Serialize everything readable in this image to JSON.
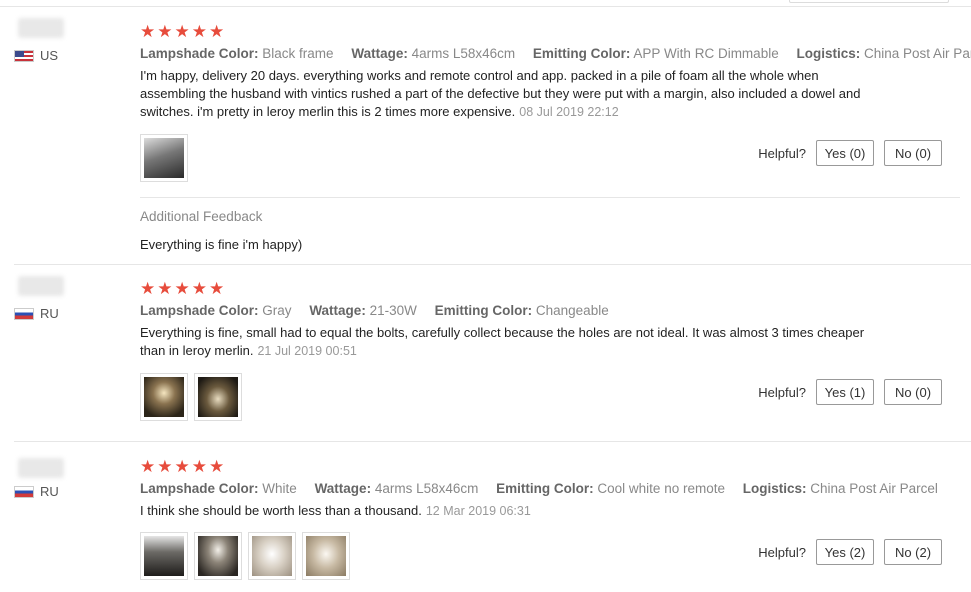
{
  "labels": {
    "helpful": "Helpful?",
    "additional_feedback": "Additional Feedback"
  },
  "reviews": [
    {
      "country": "US",
      "flag": "us-flag-icon",
      "stars": "★★★★★",
      "rating": 5,
      "attrs": [
        {
          "key": "Lampshade Color:",
          "value": "Black frame"
        },
        {
          "key": "Wattage:",
          "value": "4arms L58x46cm"
        },
        {
          "key": "Emitting Color:",
          "value": "APP With RC Dimmable"
        },
        {
          "key": "Logistics:",
          "value": "China Post Air Parcel"
        }
      ],
      "text": "I'm happy, delivery 20 days. everything works and remote control and app. packed in a pile of foam all the whole when assembling the husband with vintics rushed a part of the defective but they were put with a margin, also included a dowel and switches. i'm pretty in leroy merlin this is 2 times more expensive.",
      "date": "08 Jul 2019 22:12",
      "yes": "Yes (0)",
      "no": "No (0)",
      "additional": "Everything is fine i'm happy)"
    },
    {
      "country": "RU",
      "flag": "ru-flag-icon",
      "stars": "★★★★★",
      "rating": 5,
      "attrs": [
        {
          "key": "Lampshade Color:",
          "value": "Gray"
        },
        {
          "key": "Wattage:",
          "value": "21-30W"
        },
        {
          "key": "Emitting Color:",
          "value": "Changeable"
        }
      ],
      "text": "Everything is fine, small had to equal the bolts, carefully collect because the holes are not ideal. It was almost 3 times cheaper than in leroy merlin.",
      "date": "21 Jul 2019 00:51",
      "yes": "Yes (1)",
      "no": "No (0)"
    },
    {
      "country": "RU",
      "flag": "ru-flag-icon",
      "stars": "★★★★★",
      "rating": 5,
      "attrs": [
        {
          "key": "Lampshade Color:",
          "value": "White"
        },
        {
          "key": "Wattage:",
          "value": "4arms L58x46cm"
        },
        {
          "key": "Emitting Color:",
          "value": "Cool white no remote"
        },
        {
          "key": "Logistics:",
          "value": "China Post Air Parcel"
        }
      ],
      "text": "I think she should be worth less than a thousand.",
      "date": "12 Mar 2019 06:31",
      "yes": "Yes (2)",
      "no": "No (2)"
    }
  ]
}
